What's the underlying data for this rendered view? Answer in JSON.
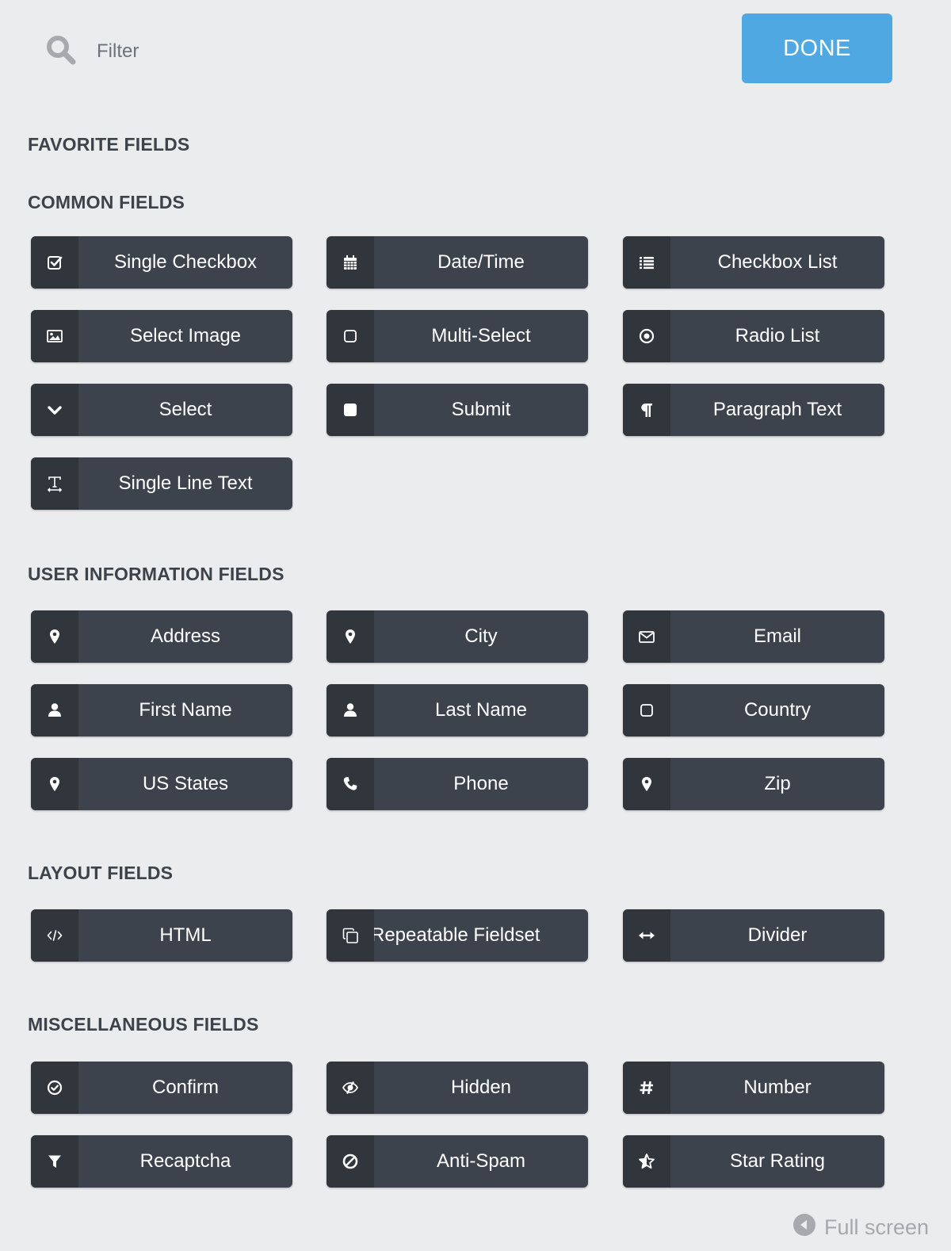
{
  "header": {
    "filter_placeholder": "Filter",
    "filter_value": "",
    "done_label": "DONE"
  },
  "colors": {
    "background": "#ebecee",
    "done_button": "#4fa8e2",
    "field_button": "#3c434c",
    "field_icon_panel": "#31363d",
    "section_title": "#3c434a"
  },
  "sections": {
    "favorite": {
      "title": "FAVORITE FIELDS",
      "items": []
    },
    "common": {
      "title": "COMMON FIELDS",
      "items": [
        {
          "label": "Single Checkbox",
          "icon": "checkbox-checked-icon"
        },
        {
          "label": "Date/Time",
          "icon": "calendar-icon"
        },
        {
          "label": "Checkbox List",
          "icon": "list-icon"
        },
        {
          "label": "Select Image",
          "icon": "image-icon"
        },
        {
          "label": "Multi-Select",
          "icon": "square-outline-icon"
        },
        {
          "label": "Radio List",
          "icon": "radio-icon"
        },
        {
          "label": "Select",
          "icon": "chevron-down-icon"
        },
        {
          "label": "Submit",
          "icon": "square-filled-icon"
        },
        {
          "label": "Paragraph Text",
          "icon": "paragraph-icon"
        },
        {
          "label": "Single Line Text",
          "icon": "text-width-icon"
        }
      ]
    },
    "user_information": {
      "title": "USER INFORMATION FIELDS",
      "items": [
        {
          "label": "Address",
          "icon": "map-marker-icon"
        },
        {
          "label": "City",
          "icon": "map-marker-icon"
        },
        {
          "label": "Email",
          "icon": "envelope-icon"
        },
        {
          "label": "First Name",
          "icon": "user-icon"
        },
        {
          "label": "Last Name",
          "icon": "user-icon"
        },
        {
          "label": "Country",
          "icon": "square-outline-icon"
        },
        {
          "label": "US States",
          "icon": "map-marker-icon"
        },
        {
          "label": "Phone",
          "icon": "phone-icon"
        },
        {
          "label": "Zip",
          "icon": "map-marker-icon"
        }
      ]
    },
    "layout": {
      "title": "LAYOUT FIELDS",
      "items": [
        {
          "label": "HTML",
          "icon": "code-icon"
        },
        {
          "label": "Repeatable Fieldset",
          "icon": "clone-icon"
        },
        {
          "label": "Divider",
          "icon": "arrows-horizontal-icon"
        }
      ]
    },
    "miscellaneous": {
      "title": "MISCELLANEOUS FIELDS",
      "items": [
        {
          "label": "Confirm",
          "icon": "check-circle-icon"
        },
        {
          "label": "Hidden",
          "icon": "eye-slash-icon"
        },
        {
          "label": "Number",
          "icon": "hashtag-icon"
        },
        {
          "label": "Recaptcha",
          "icon": "filter-icon"
        },
        {
          "label": "Anti-Spam",
          "icon": "ban-icon"
        },
        {
          "label": "Star Rating",
          "icon": "star-half-icon"
        }
      ]
    }
  },
  "footer": {
    "fullscreen_label": "Full screen",
    "fullscreen_icon": "caret-left-circle-icon"
  }
}
